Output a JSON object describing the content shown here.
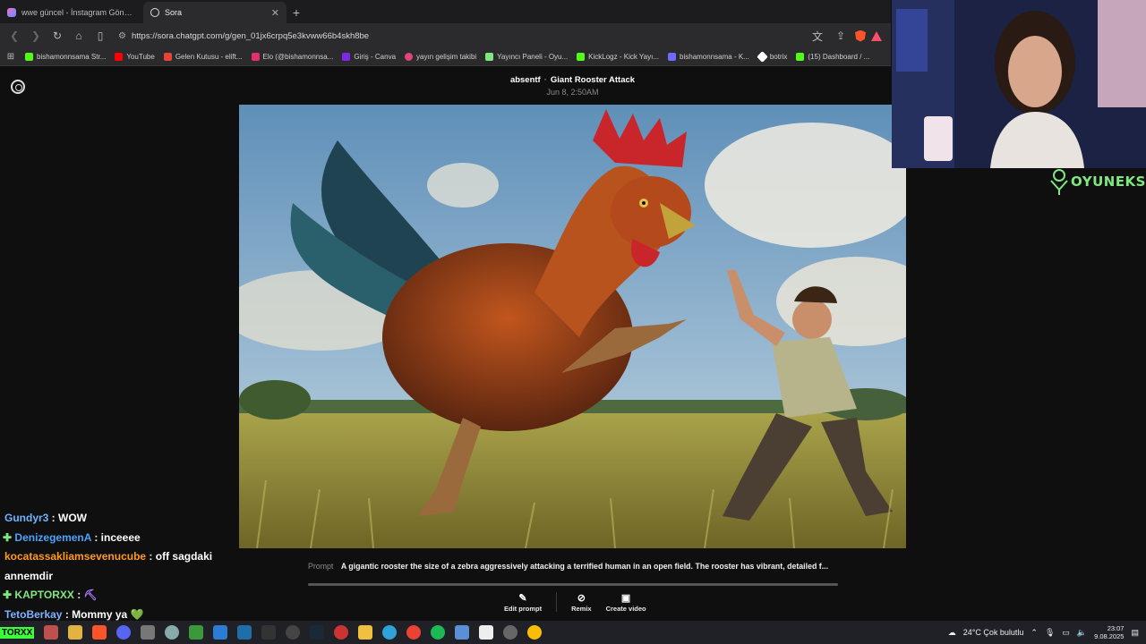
{
  "browser": {
    "tabs": [
      {
        "title": "wwe güncel - İnstagram Gönderisi",
        "active": false
      },
      {
        "title": "Sora",
        "active": true
      }
    ],
    "url": "https://sora.chatgpt.com/g/gen_01jx6crpq5e3kvww66b4skh8be",
    "bookmarks": [
      {
        "label": "bishamonnsama Str...",
        "color": "#53fc18"
      },
      {
        "label": "YouTube",
        "color": "#ff0000"
      },
      {
        "label": "Gelen Kutusu - elift...",
        "color": "#ea4335"
      },
      {
        "label": "Elo (@bishamonnsa...",
        "color": "#e1306c"
      },
      {
        "label": "Giriş - Canva",
        "color": "#7d2ae8"
      },
      {
        "label": "yayın gelişim takibi",
        "color": "#e0457b"
      },
      {
        "label": "Yayıncı Paneli - Oyu...",
        "color": "#7ee87e"
      },
      {
        "label": "KickLogz - Kick Yayı...",
        "color": "#53fc18"
      },
      {
        "label": "bishamonnsama - K...",
        "color": "#6f6bff"
      },
      {
        "label": "botrix",
        "color": "#ffffff"
      },
      {
        "label": "(15) Dashboard / ...",
        "color": "#53fc18"
      }
    ]
  },
  "sora": {
    "author": "absentf",
    "separator": "·",
    "title": "Giant Rooster Attack",
    "date": "Jun 8, 2:50AM",
    "prompt_label": "Prompt",
    "prompt_text": "A gigantic rooster the size of a zebra aggressively attacking a terrified human in an open field. The rooster has vibrant, detailed f...",
    "actions": {
      "edit": "Edit prompt",
      "remix": "Remix",
      "create_video": "Create video"
    }
  },
  "overlay": {
    "brand": "OYUNEKS"
  },
  "chat": [
    {
      "user": "Gundyr3",
      "color": "#6fb3ff",
      "badge": false,
      "message": "WOW"
    },
    {
      "user": "DenizegemenA",
      "color": "#4aa3ff",
      "badge": true,
      "message": "inceeee"
    },
    {
      "user": "kocatassakliamsevenucube",
      "color": "#ff9a1f",
      "badge": false,
      "message": "off sagdaki annemdir"
    },
    {
      "user": "KAPTORXX",
      "color": "#7ee87e",
      "badge": true,
      "message": "⛏"
    },
    {
      "user": "TetoBerkay",
      "color": "#7fb0ff",
      "badge": false,
      "message": "Mommy ya 💚"
    }
  ],
  "taskbar": {
    "label": "TORXX",
    "weather": "24°C  Çok bulutlu",
    "time": "23:07",
    "date": "9.08.2025"
  }
}
